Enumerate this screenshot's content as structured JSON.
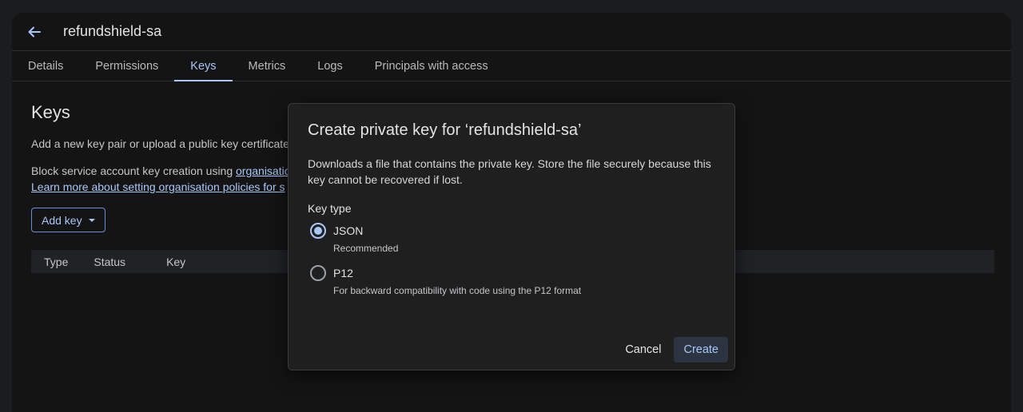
{
  "header": {
    "back_icon": "arrow-back-icon",
    "title": "refundshield-sa"
  },
  "tabs": [
    {
      "label": "Details",
      "active": false
    },
    {
      "label": "Permissions",
      "active": false
    },
    {
      "label": "Keys",
      "active": true
    },
    {
      "label": "Metrics",
      "active": false
    },
    {
      "label": "Logs",
      "active": false
    },
    {
      "label": "Principals with access",
      "active": false
    }
  ],
  "page": {
    "title": "Keys",
    "description": "Add a new key pair or upload a public key certificate",
    "policy_prefix": "Block service account key creation using ",
    "policy_link": "organisatio",
    "learn_more_link": "Learn more about setting organisation policies for s",
    "add_key_label": "Add key",
    "table_headers": [
      "Type",
      "Status",
      "Key"
    ]
  },
  "dialog": {
    "title": "Create private key for ‘refundshield-sa’",
    "body": "Downloads a file that contains the private key. Store the file securely because this key cannot be recovered if lost.",
    "key_type_label": "Key type",
    "options": [
      {
        "label": "JSON",
        "help": "Recommended",
        "selected": true
      },
      {
        "label": "P12",
        "help": "For backward compatibility with code using the P12 format",
        "selected": false
      }
    ],
    "cancel_label": "Cancel",
    "create_label": "Create"
  },
  "colors": {
    "accent": "#a8c7fa",
    "background": "#141414",
    "dialog_bg": "#1f1f1f"
  }
}
